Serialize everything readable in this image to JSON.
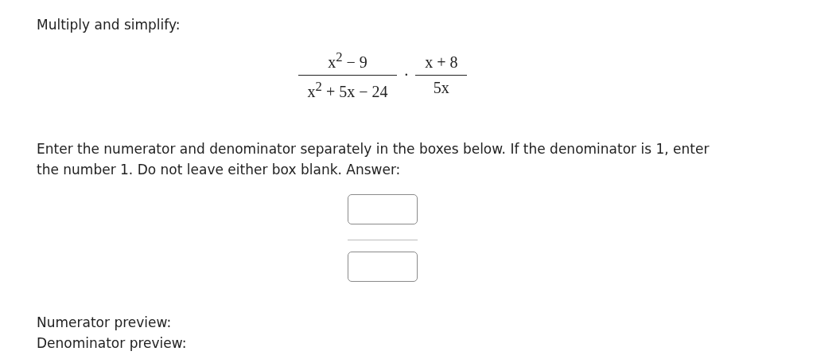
{
  "prompt": "Multiply and simplify:",
  "expression": {
    "fractions": [
      {
        "numerator": "x$^{2}$ − 9",
        "denominator": "x$^{2}$ + 5x − 24"
      },
      {
        "numerator": "x + 8",
        "denominator": "5x"
      }
    ],
    "operator": "·"
  },
  "instructions": "Enter the numerator and denominator separately in the boxes below. If the denominator is 1, enter the number 1. Do not leave either box blank. Answer:",
  "previews": [
    {
      "label": "Numerator preview:"
    },
    {
      "label": "Denominator preview:"
    }
  ]
}
